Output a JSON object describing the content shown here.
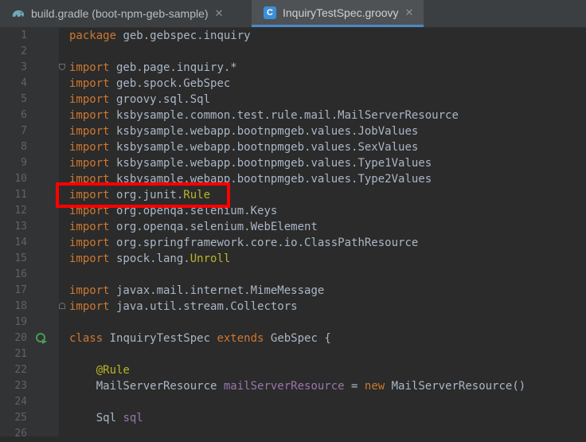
{
  "tabs": [
    {
      "label": "build.gradle (boot-npm-geb-sample)",
      "close": "✕",
      "icon": "gradle-elephant-icon"
    },
    {
      "label": "InquiryTestSpec.groovy",
      "close": "✕",
      "icon": "groovy-class-icon",
      "active": true
    }
  ],
  "groovy_icon_letter": "C",
  "lines": [
    {
      "n": "1",
      "text": "package geb.gebspec.inquiry"
    },
    {
      "n": "2",
      "text": ""
    },
    {
      "n": "3",
      "text": "import geb.page.inquiry.*"
    },
    {
      "n": "4",
      "text": "import geb.spock.GebSpec"
    },
    {
      "n": "5",
      "text": "import groovy.sql.Sql"
    },
    {
      "n": "6",
      "text": "import ksbysample.common.test.rule.mail.MailServerResource"
    },
    {
      "n": "7",
      "text": "import ksbysample.webapp.bootnpmgeb.values.JobValues"
    },
    {
      "n": "8",
      "text": "import ksbysample.webapp.bootnpmgeb.values.SexValues"
    },
    {
      "n": "9",
      "text": "import ksbysample.webapp.bootnpmgeb.values.Type1Values"
    },
    {
      "n": "10",
      "text": "import ksbysample.webapp.bootnpmgeb.values.Type2Values"
    },
    {
      "n": "11",
      "text": "import org.junit.Rule"
    },
    {
      "n": "12",
      "text": "import org.openqa.selenium.Keys"
    },
    {
      "n": "13",
      "text": "import org.openqa.selenium.WebElement"
    },
    {
      "n": "14",
      "text": "import org.springframework.core.io.ClassPathResource"
    },
    {
      "n": "15",
      "text": "import spock.lang.Unroll"
    },
    {
      "n": "16",
      "text": ""
    },
    {
      "n": "17",
      "text": "import javax.mail.internet.MimeMessage"
    },
    {
      "n": "18",
      "text": "import java.util.stream.Collectors"
    },
    {
      "n": "19",
      "text": ""
    },
    {
      "n": "20",
      "text": "class InquiryTestSpec extends GebSpec {"
    },
    {
      "n": "21",
      "text": ""
    },
    {
      "n": "22",
      "text": "    @Rule"
    },
    {
      "n": "23",
      "text": "    MailServerResource mailServerResource = new MailServerResource()"
    },
    {
      "n": "24",
      "text": ""
    },
    {
      "n": "25",
      "text": "    Sql sql"
    },
    {
      "n": "26",
      "text": ""
    }
  ],
  "colors": {
    "keyword": "#cc7832",
    "annotation": "#bbb529",
    "field": "#9876aa",
    "text": "#a9b7c6",
    "highlight_box": "#ff0000"
  },
  "highlighted_line": "11"
}
